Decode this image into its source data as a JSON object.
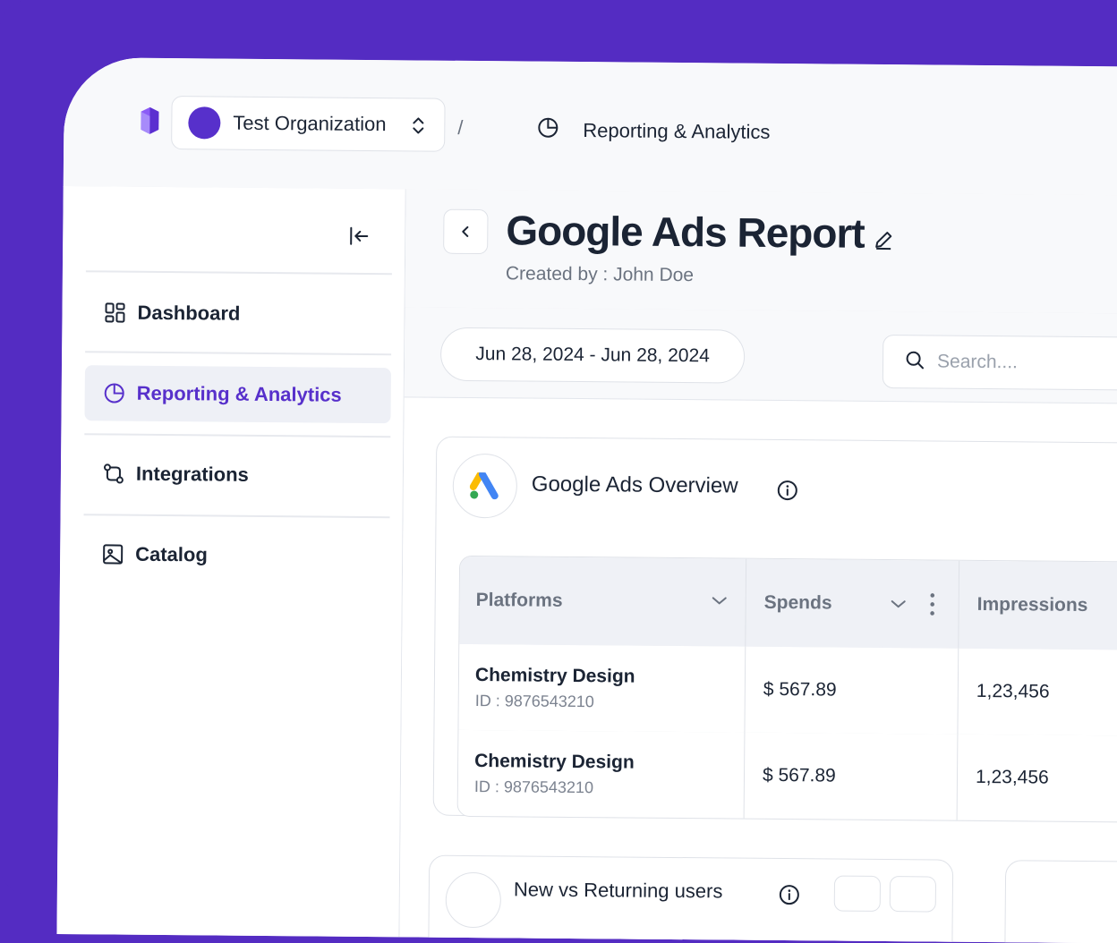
{
  "breadcrumb": {
    "organization": "Test Organization",
    "separator": "/",
    "current": "Reporting & Analytics"
  },
  "sidebar": {
    "items": [
      {
        "label": "Dashboard",
        "icon": "dashboard-grid-icon",
        "active": false
      },
      {
        "label": "Reporting & Analytics",
        "icon": "pie-chart-icon",
        "active": true
      },
      {
        "label": "Integrations",
        "icon": "git-compare-icon",
        "active": false
      },
      {
        "label": "Catalog",
        "icon": "image-icon",
        "active": false
      }
    ]
  },
  "header": {
    "title": "Google Ads Report",
    "created_by": "Created by : John Doe"
  },
  "filters": {
    "date_range": "Jun 28, 2024 - Jun 28, 2024",
    "search_placeholder": "Search...."
  },
  "overview": {
    "title": "Google Ads Overview",
    "columns": [
      "Platforms",
      "Spends",
      "Impressions"
    ],
    "rows": [
      {
        "platform": "Chemistry Design",
        "id": "ID : 9876543210",
        "spends": "$ 567.89",
        "impressions": "1,23,456"
      },
      {
        "platform": "Chemistry Design",
        "id": "ID : 9876543210",
        "spends": "$ 567.89",
        "impressions": "1,23,456"
      }
    ]
  },
  "second_card": {
    "title": "New vs Returning users"
  },
  "colors": {
    "brand": "#542cc2",
    "accent": "#5730cb",
    "text": "#1b2434",
    "muted": "#6b7380"
  }
}
